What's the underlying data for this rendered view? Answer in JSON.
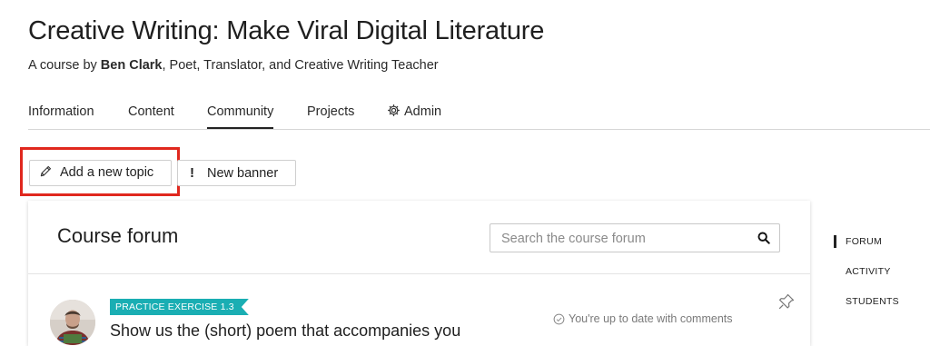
{
  "course": {
    "title": "Creative Writing: Make Viral Digital Literature",
    "byline_prefix": "A course by ",
    "author": "Ben Clark",
    "byline_suffix": ", Poet, Translator, and Creative Writing Teacher"
  },
  "tabs": [
    {
      "label": "Information",
      "active": false
    },
    {
      "label": "Content",
      "active": false
    },
    {
      "label": "Community",
      "active": true
    },
    {
      "label": "Projects",
      "active": false
    },
    {
      "label": "Admin",
      "active": false,
      "icon": "gear-icon"
    }
  ],
  "actions": {
    "add_topic_label": "Add a new topic",
    "add_topic_icon": "pencil-icon",
    "new_banner_label": "New banner",
    "new_banner_icon": "!"
  },
  "forum": {
    "title": "Course forum",
    "search_placeholder": "Search the course forum",
    "search_value": "",
    "topic": {
      "tag": "PRACTICE EXERCISE 1.3",
      "tag_color": "#1aaeb3",
      "title": "Show us the (short) poem that accompanies you",
      "status": "You're up to date with comments"
    }
  },
  "side_nav": [
    {
      "label": "FORUM",
      "active": true
    },
    {
      "label": "ACTIVITY",
      "active": false
    },
    {
      "label": "STUDENTS",
      "active": false
    }
  ],
  "colors": {
    "highlight": "#e0281e",
    "text": "#222222"
  }
}
